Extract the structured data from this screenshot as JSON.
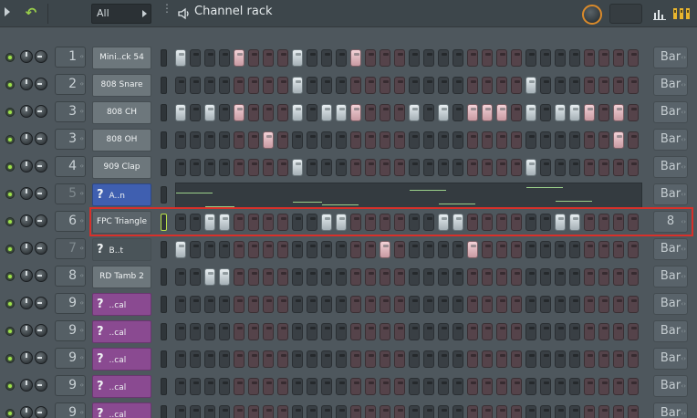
{
  "header": {
    "filter_value": "All",
    "title": "Channel rack"
  },
  "channels": [
    {
      "route": "1",
      "name": "Mini..ck 54",
      "style": "plain",
      "route_dim": false,
      "bar": "Bar",
      "steps": [
        1,
        0,
        0,
        0,
        1,
        0,
        0,
        0,
        1,
        0,
        0,
        0,
        1,
        0,
        0,
        0,
        0,
        0,
        0,
        0,
        0,
        0,
        0,
        0,
        0,
        0,
        0,
        0,
        0,
        0,
        0,
        0
      ]
    },
    {
      "route": "2",
      "name": "808 Snare",
      "style": "plain",
      "route_dim": false,
      "bar": "Bar",
      "steps": [
        0,
        0,
        0,
        0,
        0,
        0,
        0,
        0,
        1,
        0,
        0,
        0,
        0,
        0,
        0,
        0,
        0,
        0,
        0,
        0,
        0,
        0,
        0,
        0,
        1,
        0,
        0,
        0,
        0,
        0,
        0,
        0
      ]
    },
    {
      "route": "3",
      "name": "808 CH",
      "style": "plain",
      "route_dim": false,
      "bar": "Bar",
      "steps": [
        1,
        0,
        1,
        0,
        1,
        0,
        0,
        0,
        1,
        0,
        1,
        1,
        1,
        0,
        0,
        0,
        1,
        0,
        1,
        0,
        1,
        1,
        1,
        0,
        1,
        0,
        1,
        1,
        1,
        0,
        1,
        0
      ]
    },
    {
      "route": "3",
      "name": "808 OH",
      "style": "plain",
      "route_dim": false,
      "bar": "Bar",
      "steps": [
        0,
        0,
        0,
        0,
        0,
        0,
        1,
        0,
        0,
        0,
        0,
        0,
        0,
        0,
        0,
        0,
        0,
        0,
        0,
        0,
        0,
        0,
        0,
        0,
        0,
        0,
        0,
        0,
        0,
        0,
        1,
        0
      ]
    },
    {
      "route": "4",
      "name": "909 Clap",
      "style": "plain",
      "route_dim": false,
      "bar": "Bar",
      "steps": [
        0,
        0,
        0,
        0,
        0,
        0,
        0,
        0,
        1,
        0,
        0,
        0,
        0,
        0,
        0,
        0,
        0,
        0,
        0,
        0,
        0,
        0,
        0,
        0,
        1,
        0,
        0,
        0,
        0,
        0,
        0,
        0
      ]
    },
    {
      "route": "5",
      "name": "A..n",
      "style": "blue",
      "route_dim": true,
      "bar": "Bar",
      "graph": true,
      "steps": []
    },
    {
      "route": "6",
      "name": "FPC Triangle",
      "style": "selected",
      "route_dim": false,
      "bar": "8",
      "selected": true,
      "steps": [
        0,
        0,
        1,
        1,
        0,
        0,
        0,
        0,
        0,
        0,
        1,
        1,
        0,
        0,
        0,
        0,
        0,
        0,
        1,
        1,
        0,
        0,
        0,
        0,
        0,
        0,
        1,
        1,
        0,
        0,
        0,
        0
      ]
    },
    {
      "route": "7",
      "name": "B..t",
      "style": "dark",
      "route_dim": true,
      "bar": "Bar",
      "steps": [
        1,
        0,
        0,
        0,
        0,
        0,
        0,
        0,
        0,
        0,
        0,
        0,
        0,
        0,
        1,
        0,
        0,
        0,
        0,
        0,
        1,
        0,
        0,
        0,
        0,
        0,
        0,
        0,
        0,
        0,
        0,
        0
      ]
    },
    {
      "route": "8",
      "name": "RD Tamb 2",
      "style": "plain",
      "route_dim": false,
      "bar": "Bar",
      "steps": [
        0,
        0,
        1,
        1,
        0,
        0,
        0,
        0,
        0,
        0,
        0,
        0,
        0,
        0,
        0,
        0,
        0,
        0,
        0,
        0,
        0,
        0,
        0,
        0,
        0,
        0,
        0,
        0,
        0,
        0,
        0,
        0
      ]
    },
    {
      "route": "9",
      "name": "..cal",
      "style": "purple",
      "route_dim": false,
      "bar": "Bar",
      "steps": [
        0,
        0,
        0,
        0,
        0,
        0,
        0,
        0,
        0,
        0,
        0,
        0,
        0,
        0,
        0,
        0,
        0,
        0,
        0,
        0,
        0,
        0,
        0,
        0,
        0,
        0,
        0,
        0,
        0,
        0,
        0,
        0
      ]
    },
    {
      "route": "9",
      "name": "..cal",
      "style": "purple",
      "route_dim": false,
      "bar": "Bar",
      "steps": [
        0,
        0,
        0,
        0,
        0,
        0,
        0,
        0,
        0,
        0,
        0,
        0,
        0,
        0,
        0,
        0,
        0,
        0,
        0,
        0,
        0,
        0,
        0,
        0,
        0,
        0,
        0,
        0,
        0,
        0,
        0,
        0
      ]
    },
    {
      "route": "9",
      "name": "..cal",
      "style": "purple",
      "route_dim": false,
      "bar": "Bar",
      "steps": [
        0,
        0,
        0,
        0,
        0,
        0,
        0,
        0,
        0,
        0,
        0,
        0,
        0,
        0,
        0,
        0,
        0,
        0,
        0,
        0,
        0,
        0,
        0,
        0,
        0,
        0,
        0,
        0,
        0,
        0,
        0,
        0
      ]
    },
    {
      "route": "9",
      "name": "..cal",
      "style": "purple",
      "route_dim": false,
      "bar": "Bar",
      "steps": [
        0,
        0,
        0,
        0,
        0,
        0,
        0,
        0,
        0,
        0,
        0,
        0,
        0,
        0,
        0,
        0,
        0,
        0,
        0,
        0,
        0,
        0,
        0,
        0,
        0,
        0,
        0,
        0,
        0,
        0,
        0,
        0
      ]
    },
    {
      "route": "9",
      "name": "..cal",
      "style": "purple",
      "route_dim": false,
      "bar": "Bar",
      "steps": [
        0,
        0,
        0,
        0,
        0,
        0,
        0,
        0,
        0,
        0,
        0,
        0,
        0,
        0,
        0,
        0,
        0,
        0,
        0,
        0,
        0,
        0,
        0,
        0,
        0,
        0,
        0,
        0,
        0,
        0,
        0,
        0
      ]
    }
  ],
  "piano_roll_notes": [
    {
      "start_step": 0,
      "length_steps": 2.5
    },
    {
      "start_step": 2,
      "length_steps": 2
    },
    {
      "start_step": 8,
      "length_steps": 2
    },
    {
      "start_step": 10,
      "length_steps": 2.5
    },
    {
      "start_step": 16,
      "length_steps": 2.5
    },
    {
      "start_step": 18,
      "length_steps": 2.5
    },
    {
      "start_step": 24,
      "length_steps": 2.5
    },
    {
      "start_step": 26,
      "length_steps": 2.5
    }
  ],
  "accent_colors": {
    "mute_led": "#9de04a",
    "selection_outline": "#d8302a",
    "knob_ring": "#d98a2b"
  }
}
